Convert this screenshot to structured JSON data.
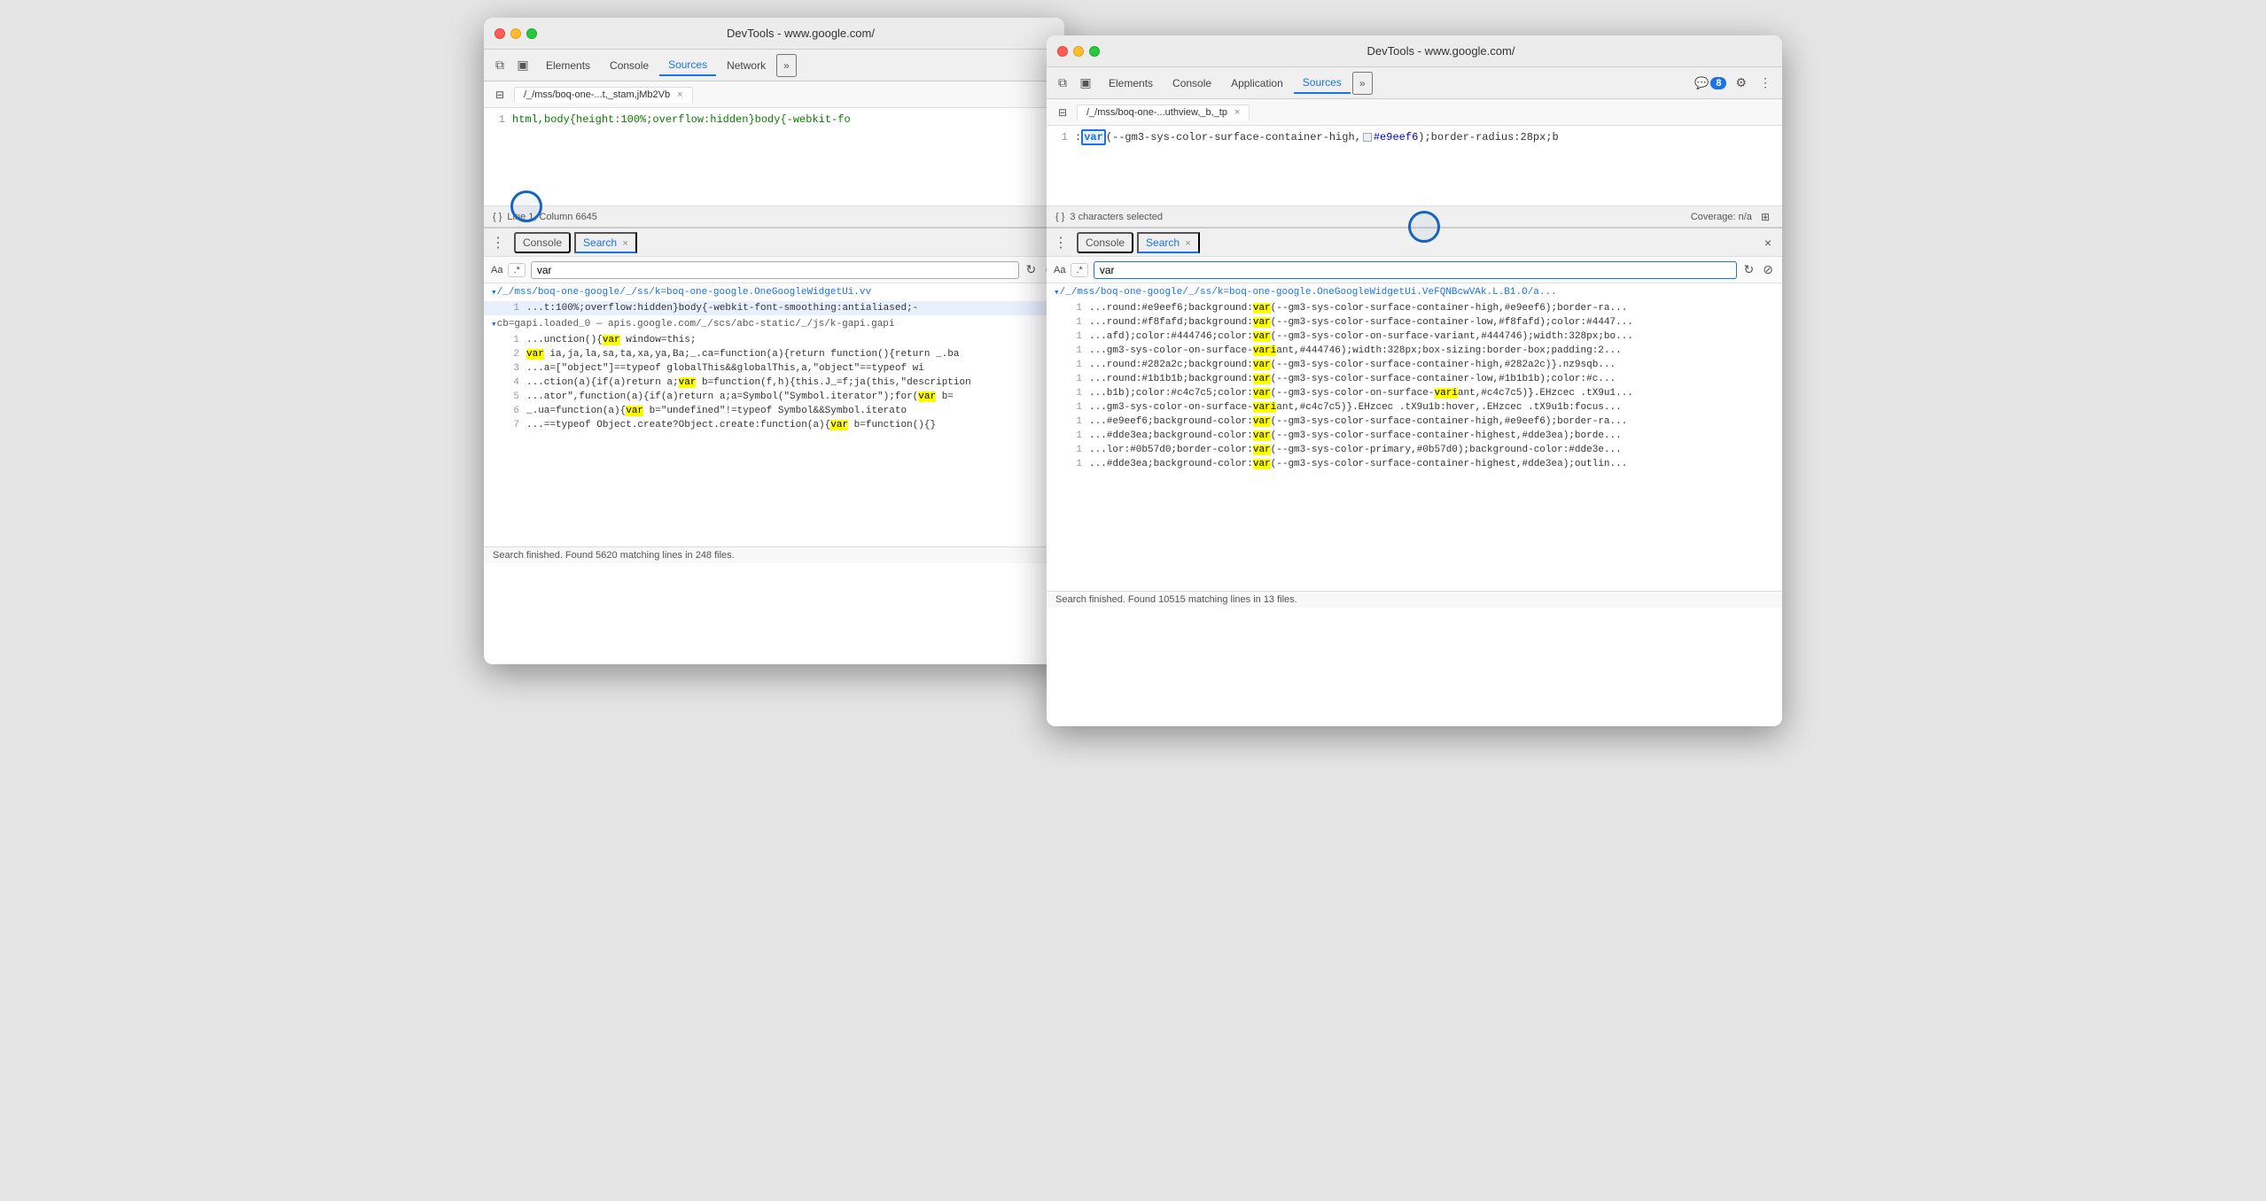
{
  "left_window": {
    "title": "DevTools - www.google.com/",
    "tabs": [
      "Elements",
      "Console",
      "Sources",
      "Network",
      "»"
    ],
    "active_tab": "Sources",
    "filetab": {
      "label": "/_/mss/boq-one-...t,_stam,jMb2Vb"
    },
    "code": {
      "line_num": "1",
      "content": "html,body{height:100%;overflow:hidden}body{-webkit-fo"
    },
    "status": "Line 1, Column 6645",
    "panel": {
      "tabs": [
        "Console",
        "Search"
      ],
      "active_tab": "Search",
      "search_query": "var",
      "search_placeholder": "Search",
      "results_file1": "▾/_/mss/boq-one-google/_/ss/k=boq-one-google.OneGoogleWidgetUi.vv",
      "results": [
        {
          "line": "1",
          "text": "...t:100%;overflow:hidden}body{-webkit-font-smoothing:antialiased;-",
          "highlight_pos": null,
          "highlight_word": "var",
          "active": true
        }
      ],
      "results_file2": "▾cb=gapi.loaded_0  —  apis.google.com/_/scs/abc-static/_/js/k-gapi.gapi",
      "results2": [
        {
          "line": "1",
          "text": "...unction(){",
          "highlight_word": "var",
          "suffix": " window=this;"
        },
        {
          "line": "2",
          "text": "",
          "prefix": "",
          "highlight_word": "var",
          "full": "var ia,ja,la,sa,ta,xa,ya,Ba;_.ca=function(a){return function(){return _.ba"
        },
        {
          "line": "3",
          "text": "...a=[\"object\"]==typeof globalThis&&globalThis,a,\"object\"==typeof wi"
        },
        {
          "line": "4",
          "text": "...ction(a){if(a)return a;",
          "highlight_word": "var",
          "suffix": " b=function(f,h){this.J_=f;ja(this,\"description"
        },
        {
          "line": "5",
          "text": "...ator\",function(a){if(a)return a;a=Symbol(\"Symbol.iterator\");for(",
          "highlight_word": "var",
          "suffix": " b="
        },
        {
          "line": "6",
          "text": "_.ua=function(a){",
          "highlight_word": "var",
          "suffix": " b=\"undefined\"!=typeof Symbol&&Symbol.iterato"
        },
        {
          "line": "7",
          "text": "...==typeof Object.create?Object.create:function(a){",
          "highlight_word": "var",
          "suffix": " b=function(){}"
        }
      ],
      "status": "Search finished.  Found 5620 matching lines in 248 files."
    }
  },
  "right_window": {
    "title": "DevTools - www.google.com/",
    "tabs": [
      "Elements",
      "Console",
      "Application",
      "Sources",
      "»"
    ],
    "active_tab": "Sources",
    "badge": "8",
    "filetab": {
      "label": "/_/mss/boq-one-...uthview,_b,_tp"
    },
    "code": {
      "line_num": "1",
      "content": ":var(--gm3-sys-color-surface-container-high,",
      "color_swatch": "#e9eef6",
      "content2": "#e9eef6);border-radius:28px;b"
    },
    "status_selected": "3 characters selected",
    "coverage": "Coverage: n/a",
    "panel": {
      "tabs": [
        "Console",
        "Search"
      ],
      "active_tab": "Search",
      "search_query": "var",
      "search_placeholder": "Search",
      "results_file1": "▾/_/mss/boq-one-google/_/ss/k=boq-one-google.OneGoogleWidgetUi.VeFQNBcwVAk.L.B1.O/a...",
      "results": [
        {
          "line": "1",
          "text": "...round:#e9eef6;background:",
          "highlight": "var",
          "suffix": "(--gm3-sys-color-surface-container-high,#e9eef6);border-ra..."
        },
        {
          "line": "1",
          "text": "...round:#f8fafd;background:",
          "highlight": "var",
          "suffix": "(--gm3-sys-color-surface-container-low,#f8fafd);color:#4447..."
        },
        {
          "line": "1",
          "text": "...afd);color:#444746;color:",
          "highlight": "var",
          "suffix": "(--gm3-sys-color-on-surface-variant,#444746);width:328px;bo..."
        },
        {
          "line": "1",
          "text": "...gm3-sys-color-on-surface-variant,#444746);width:328px;box-sizing:border-box;padding:2..."
        },
        {
          "line": "1",
          "text": "...round:#282a2c;background:",
          "highlight": "var",
          "suffix": "(--gm3-sys-color-surface-container-high,#282a2c)}.nz9sqb..."
        },
        {
          "line": "1",
          "text": "...round:#1b1b1b;background:",
          "highlight": "var",
          "suffix": "(--gm3-sys-color-surface-container-low,#1b1b1b);color:#c..."
        },
        {
          "line": "1",
          "text": "...b1b);color:#c4c7c5;color:",
          "highlight": "var",
          "suffix": "(--gm3-sys-color-on-surface-variant,#c4c7c5)}.EHzcec .tX9u1..."
        },
        {
          "line": "1",
          "text": "...gm3-sys-color-on-surface-variant,#c4c7c5)}.EHzcec .tX9u1b:hover,.EHzcec .tX9u1b:focus..."
        },
        {
          "line": "1",
          "text": "...#e9eef6;background-color:",
          "highlight": "var",
          "suffix": "(--gm3-sys-color-surface-container-high,#e9eef6);border-ra..."
        },
        {
          "line": "1",
          "text": "...#dde3ea;background-color:",
          "highlight": "var",
          "suffix": "(--gm3-sys-color-surface-container-highest,#dde3ea);borde..."
        },
        {
          "line": "1",
          "text": "...lor:#0b57d0;border-color:",
          "highlight": "var",
          "suffix": "(--gm3-sys-color-primary,#0b57d0);background-color:#dde3e..."
        },
        {
          "line": "1",
          "text": "...#dde3ea;background-color:",
          "highlight": "var",
          "suffix": "(--gm3-sys-color-surface-container-highest,#dde3ea);outlin..."
        }
      ],
      "status": "Search finished.  Found 10515 matching lines in 13 files."
    }
  },
  "icons": {
    "close": "×",
    "refresh": "↻",
    "clear": "⊘",
    "more_vert": "⋮",
    "console_icon": "≡",
    "gear": "⚙",
    "panel_icon": "{ }",
    "sidebar_icon": "⊟",
    "inspector": "⧉",
    "devices": "▣"
  }
}
